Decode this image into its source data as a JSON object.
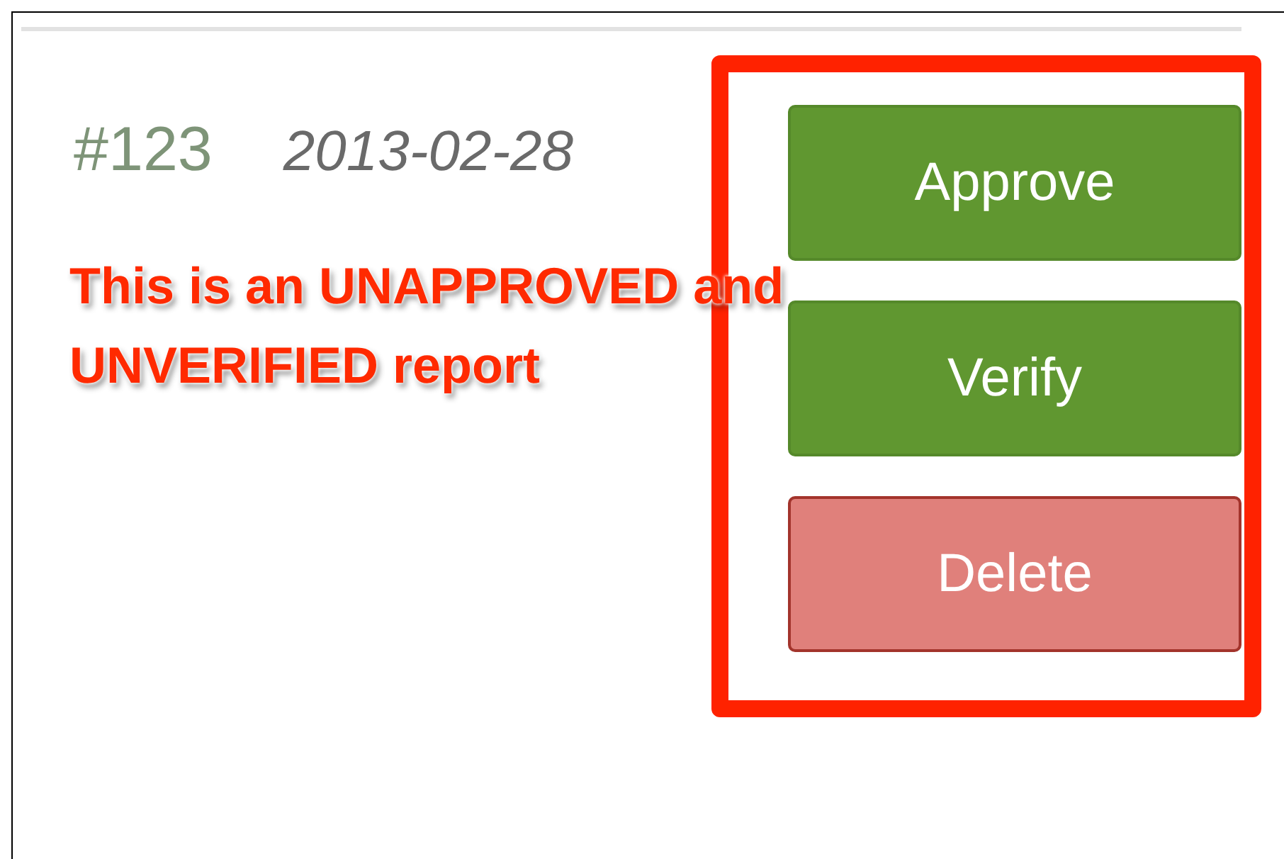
{
  "report": {
    "number": "#123",
    "date": "2013-02-28"
  },
  "buttons": [
    {
      "label": "Approve",
      "kind": "success"
    },
    {
      "label": "Verify",
      "kind": "success"
    },
    {
      "label": "Delete",
      "kind": "danger"
    }
  ],
  "annotation": "This is an UNAPPROVED and UNVERIFIED report"
}
